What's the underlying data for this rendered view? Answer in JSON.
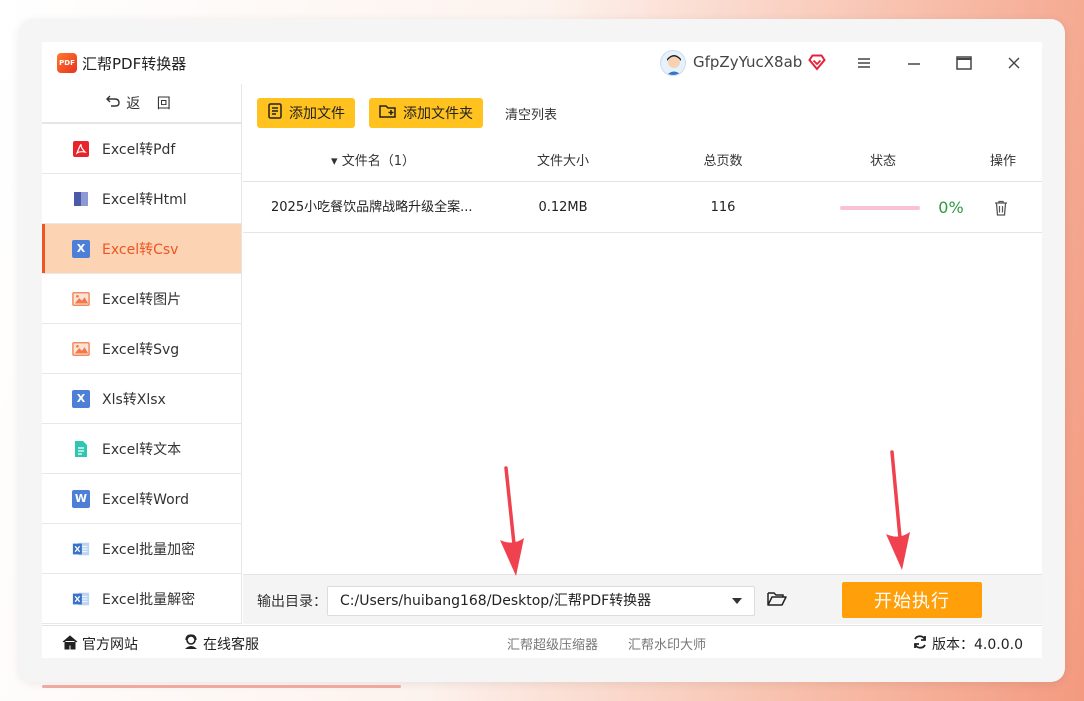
{
  "app": {
    "title": "汇帮PDF转换器",
    "logo_text": "PDF",
    "user_name": "GfpZyYucX8ab"
  },
  "sidebar": {
    "back_label": "返 回",
    "items": [
      {
        "label": "Excel转Pdf",
        "icon": "pdf-icon",
        "active": false
      },
      {
        "label": "Excel转Html",
        "icon": "html-icon",
        "active": false
      },
      {
        "label": "Excel转Csv",
        "icon": "csv-icon",
        "active": true
      },
      {
        "label": "Excel转图片",
        "icon": "image-icon",
        "active": false
      },
      {
        "label": "Excel转Svg",
        "icon": "image-icon",
        "active": false
      },
      {
        "label": "Xls转Xlsx",
        "icon": "excel-x-icon",
        "active": false
      },
      {
        "label": "Excel转文本",
        "icon": "text-icon",
        "active": false
      },
      {
        "label": "Excel转Word",
        "icon": "word-icon",
        "active": false
      },
      {
        "label": "Excel批量加密",
        "icon": "excel-icon",
        "active": false
      },
      {
        "label": "Excel批量解密",
        "icon": "excel-icon",
        "active": false
      }
    ]
  },
  "toolbar": {
    "add_file": "添加文件",
    "add_folder": "添加文件夹",
    "clear_list": "清空列表"
  },
  "table": {
    "headers": {
      "filename": "文件名（1）",
      "size": "文件大小",
      "pages": "总页数",
      "status": "状态",
      "action": "操作"
    },
    "rows": [
      {
        "filename": "2025小吃餐饮品牌战略升级全案...",
        "size": "0.12MB",
        "pages": "116",
        "progress": 0,
        "percent": "0%"
      }
    ]
  },
  "output": {
    "label": "输出目录：",
    "path": "C:/Users/huibang168/Desktop/汇帮PDF转换器",
    "start_button": "开始执行"
  },
  "statusbar": {
    "website": "官方网站",
    "support": "在线客服",
    "compressor": "汇帮超级压缩器",
    "watermark": "汇帮水印大师",
    "version": "版本：4.0.0.0"
  },
  "colors": {
    "accent": "#f05422",
    "toolbar_button": "#ffc21f",
    "start_button": "#ff9f0a",
    "progress_ok": "#2e9a3e"
  }
}
